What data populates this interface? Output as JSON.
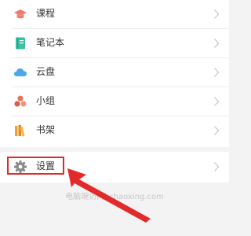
{
  "menu": {
    "items": [
      {
        "label": "课程",
        "icon": "graduation-cap-icon"
      },
      {
        "label": "笔记本",
        "icon": "notebook-icon"
      },
      {
        "label": "云盘",
        "icon": "cloud-icon"
      },
      {
        "label": "小组",
        "icon": "group-icon"
      },
      {
        "label": "书架",
        "icon": "bookshelf-icon"
      }
    ]
  },
  "settings": {
    "label": "设置",
    "icon": "gear-icon"
  },
  "footer": {
    "site_text": "电脑端访问i.chaoxing.com"
  },
  "colors": {
    "annotation": "#e32a2a",
    "course_icon": "#f07a6a",
    "notebook_icon": "#3dbfa3",
    "cloud_icon": "#4aa8e8",
    "group_icon": "#e8745a",
    "bookshelf_icon": "#f0a030",
    "settings_icon": "#8a8a8a"
  }
}
